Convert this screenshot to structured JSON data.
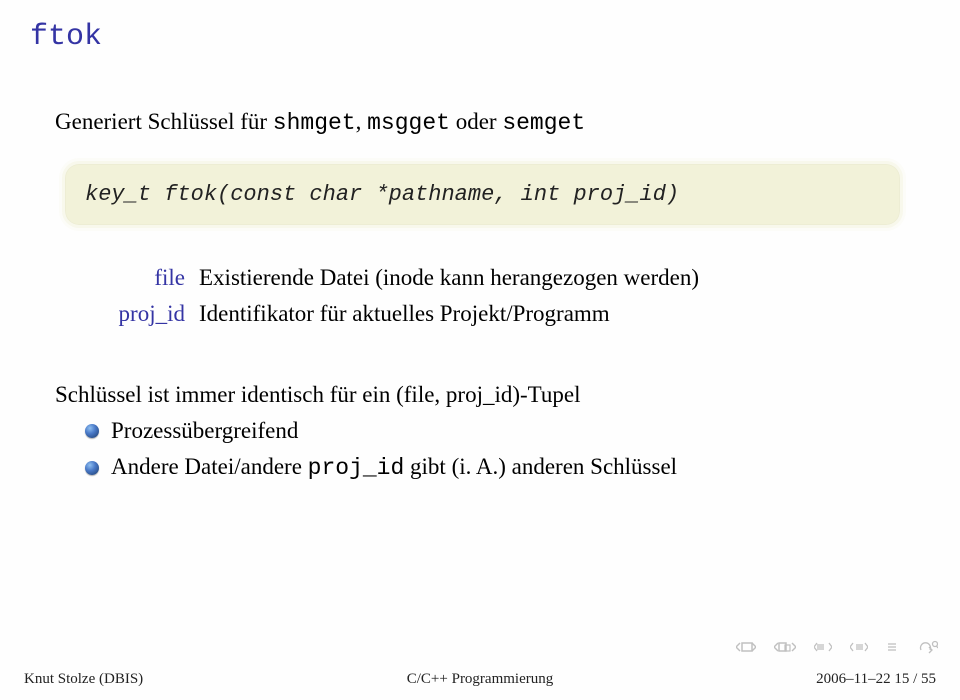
{
  "title": "ftok",
  "intro": {
    "prefix": "Generiert Schlüssel für ",
    "fn1": "shmget",
    "sep1": ", ",
    "fn2": "msgget",
    "sep2": " oder ",
    "fn3": "semget"
  },
  "code": {
    "line": "key_t ftok(const char *pathname, int proj_id)"
  },
  "defs": {
    "file": {
      "term": "file",
      "desc": "Existierende Datei (inode kann herangezogen werden)"
    },
    "projid": {
      "term": "proj_id",
      "desc": "Identifikator für aktuelles Projekt/Programm"
    }
  },
  "block2": "Schlüssel ist immer identisch für ein (file, proj_id)-Tupel",
  "bullets": {
    "b1": "Prozessübergreifend",
    "b2_pre": "Andere Datei/andere ",
    "b2_code": "proj_id",
    "b2_post": " gibt (i. A.) anderen Schlüssel"
  },
  "footer": {
    "left": "Knut Stolze (DBIS)",
    "center": "C/C++ Programmierung",
    "right": "2006–11–22      15 / 55"
  }
}
